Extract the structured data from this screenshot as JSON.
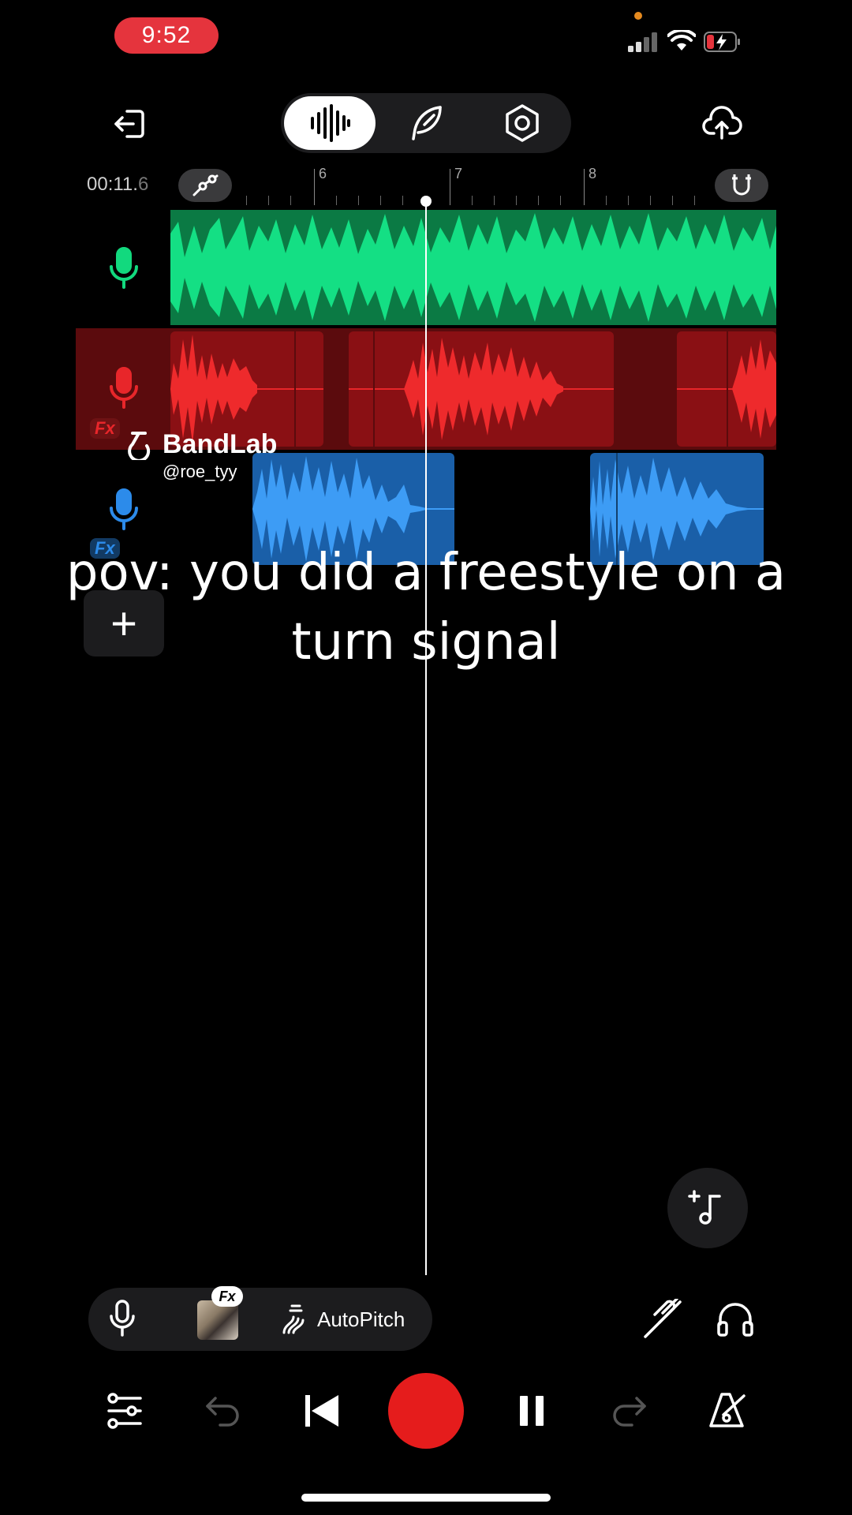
{
  "status_bar": {
    "time": "9:52"
  },
  "toolbar": {
    "back_icon": "exit-icon",
    "modes": [
      {
        "name": "waveform-mode",
        "icon": "waveform-icon",
        "active": true
      },
      {
        "name": "lyrics-mode",
        "icon": "feather-icon",
        "active": false
      },
      {
        "name": "settings-mode",
        "icon": "hex-nut-icon",
        "active": false
      }
    ],
    "upload_icon": "cloud-upload-icon"
  },
  "timeline": {
    "time_main": "00:11.",
    "time_fraction": "6",
    "ruler_numbers": [
      "6",
      "7",
      "8"
    ]
  },
  "tracks": [
    {
      "name": "track-1",
      "color": "#12d97e",
      "icon": "microphone-icon",
      "fx": false
    },
    {
      "name": "track-2",
      "color": "#e8262a",
      "icon": "microphone-icon",
      "fx": true,
      "fx_label": "Fx"
    },
    {
      "name": "track-3",
      "color": "#2c8bea",
      "icon": "microphone-icon",
      "fx": true,
      "fx_label": "Fx"
    }
  ],
  "watermark": {
    "brand": "BandLab",
    "handle": "@roe_tyy"
  },
  "caption": {
    "line1": "pov: you did a freestyle on a",
    "line2": "turn signal"
  },
  "add_track_label": "+",
  "effects_bar": {
    "fx_badge": "Fx",
    "autopitch_label": "AutoPitch"
  },
  "transport": {
    "record_color": "#e51c1c"
  }
}
